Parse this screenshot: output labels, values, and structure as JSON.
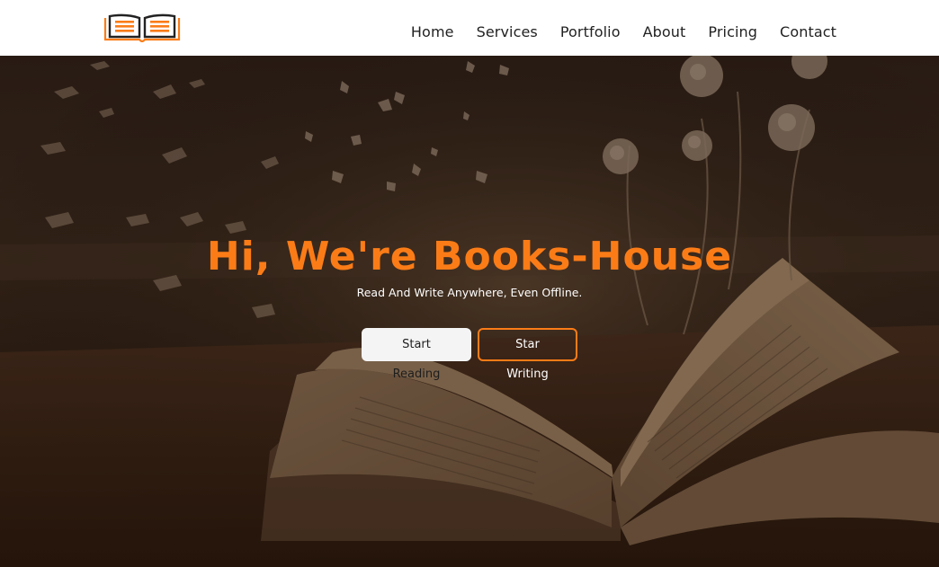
{
  "brand": {
    "logo_icon": "open-book-icon",
    "accent_color": "#fb7c17"
  },
  "nav": {
    "items": [
      {
        "label": "Home"
      },
      {
        "label": "Services"
      },
      {
        "label": "Portfolio"
      },
      {
        "label": "About"
      },
      {
        "label": "Pricing"
      },
      {
        "label": "Contact"
      }
    ]
  },
  "hero": {
    "title": "Hi, We're Books-House",
    "subtitle": "Read And Write Anywhere, Even Offline.",
    "primary_button": "Start Reading",
    "secondary_button": "Star Writing",
    "background": "open-book-with-butterflies-and-birds-image"
  }
}
